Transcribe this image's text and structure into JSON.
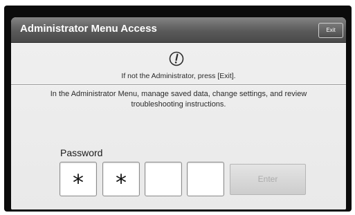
{
  "dialog": {
    "title": "Administrator Menu Access",
    "exit_label": "Exit"
  },
  "notice": {
    "icon": "alert-circle-icon",
    "text": "If not the Administrator, press [Exit]."
  },
  "description": {
    "line1": "In the Administrator Menu, manage saved data, change settings, and review",
    "line2": "troubleshooting instructions."
  },
  "password": {
    "label": "Password",
    "digits": [
      "*",
      "*",
      "",
      ""
    ],
    "enter_label": "Enter",
    "enter_enabled": false
  },
  "colors": {
    "titlebar": "#5a5a5a",
    "panel_background": "#efefef",
    "enter_disabled_text": "#ababab"
  }
}
